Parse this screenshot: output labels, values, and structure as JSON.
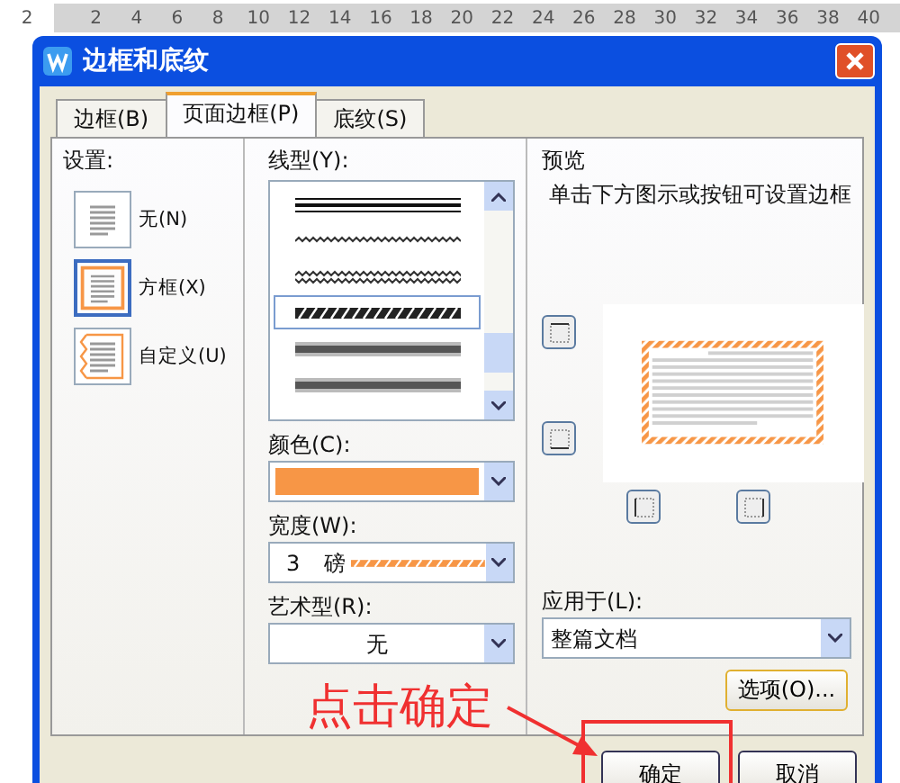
{
  "ruler": {
    "labels": [
      "2",
      "2",
      "4",
      "6",
      "8",
      "10",
      "12",
      "14",
      "16",
      "18",
      "20",
      "22",
      "24",
      "26",
      "28",
      "30",
      "32",
      "34",
      "36",
      "38",
      "40"
    ]
  },
  "dialog": {
    "title": "边框和底纹"
  },
  "tabs": [
    {
      "label": "边框(B)",
      "selected": false
    },
    {
      "label": "页面边框(P)",
      "selected": true
    },
    {
      "label": "底纹(S)",
      "selected": false
    }
  ],
  "settings": {
    "label": "设置:",
    "items": [
      {
        "label": "无(N)",
        "kind": "none",
        "selected": false
      },
      {
        "label": "方框(X)",
        "kind": "box",
        "selected": true
      },
      {
        "label": "自定义(U)",
        "kind": "custom",
        "selected": false
      }
    ]
  },
  "line_style": {
    "label": "线型(Y):",
    "items": [
      {
        "kind": "triple",
        "selected": false
      },
      {
        "kind": "wave",
        "selected": false
      },
      {
        "kind": "double-wave",
        "selected": false
      },
      {
        "kind": "hatched",
        "selected": true
      },
      {
        "kind": "thick",
        "selected": false
      },
      {
        "kind": "thick",
        "selected": false
      }
    ]
  },
  "color": {
    "label": "颜色(C):",
    "color": "#f79646"
  },
  "width": {
    "label": "宽度(W):",
    "value": "3",
    "unit": "磅"
  },
  "art": {
    "label": "艺术型(R):",
    "value": "无"
  },
  "preview": {
    "label": "预览",
    "hint": "单击下方图示或按钮可设置边框"
  },
  "apply_to": {
    "label": "应用于(L):",
    "value": "整篇文档"
  },
  "options_button": {
    "label": "选项(O)..."
  },
  "buttons": [
    {
      "label": "确定"
    },
    {
      "label": "取消"
    }
  ],
  "annotation": {
    "text": "点击确定"
  }
}
